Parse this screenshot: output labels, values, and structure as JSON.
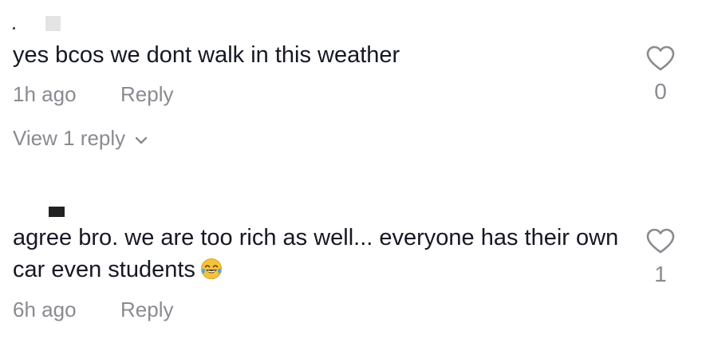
{
  "comments": [
    {
      "text": "yes bcos we dont walk in this weather",
      "time": "1h ago",
      "reply_label": "Reply",
      "like_count": "0",
      "view_replies_label": "View 1 reply"
    },
    {
      "text": "agree bro. we are too rich as well... everyone has their own car even students",
      "time": "6h ago",
      "reply_label": "Reply",
      "like_count": "1",
      "emoji": "face-with-tears-of-joy"
    }
  ],
  "icons": {
    "like": "heart-outline-icon",
    "expand": "chevron-down-icon"
  },
  "colors": {
    "text_primary": "#161823",
    "text_secondary": "#8a8b91"
  }
}
